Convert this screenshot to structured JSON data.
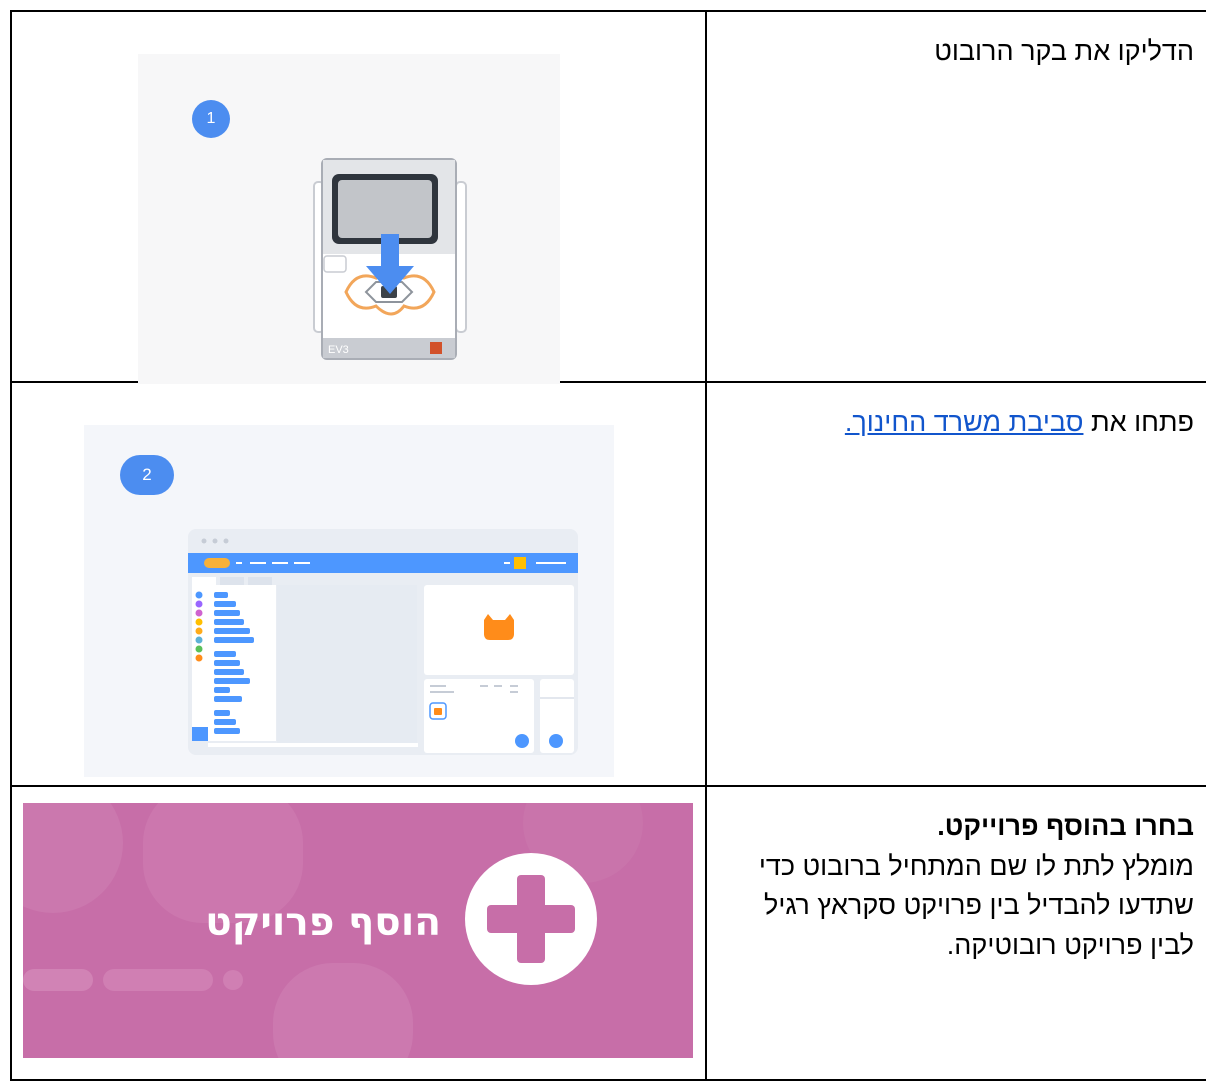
{
  "rows": [
    {
      "text": "הדליקו את בקר הרובוט",
      "image": {
        "badge": "1",
        "device_label": "EV3",
        "icon": "ev3-brick-icon"
      }
    },
    {
      "text_prefix": "פתחו את ",
      "link_text": "סביבת משרד החינוך.",
      "image": {
        "badge": "2",
        "icon": "scratch-editor-icon"
      }
    },
    {
      "title": "בחרו בהוסף פרוייקט.",
      "body": "מומלץ לתת לו שם המתחיל ברובוט כדי שתדעו להבדיל בין פרויקט סקראץ רגיל לבין פרויקט רובוטיקה.",
      "image": {
        "button_label": "הוסף פרויקט",
        "icon": "plus-circle-icon"
      }
    }
  ],
  "colors": {
    "link": "#1155cc",
    "badge": "#4c8df0",
    "banner": "#c76ea8",
    "editor_bar": "#4d97ff"
  }
}
